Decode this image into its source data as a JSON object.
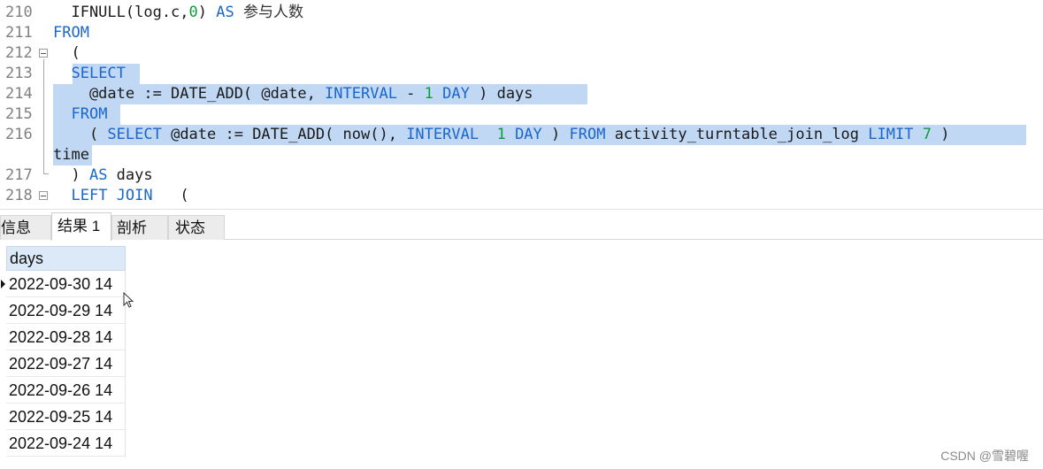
{
  "editor": {
    "lines": [
      {
        "num": "210",
        "tokens": [
          [
            "",
            "  IFNULL(log.c,"
          ],
          [
            "num",
            "0"
          ],
          [
            "",
            ") "
          ],
          [
            "kw",
            "AS"
          ],
          [
            "cn",
            " 参与人数"
          ]
        ]
      },
      {
        "num": "211",
        "tokens": [
          [
            "kw",
            "FROM"
          ]
        ]
      },
      {
        "num": "212",
        "tokens": [
          [
            "",
            "  ("
          ]
        ]
      },
      {
        "num": "213",
        "tokens": [
          [
            "",
            "  "
          ],
          [
            "kw",
            "SELECT"
          ]
        ]
      },
      {
        "num": "214",
        "tokens": [
          [
            "",
            "    @date := DATE_ADD( @date, "
          ],
          [
            "kw",
            "INTERVAL"
          ],
          [
            "",
            " - "
          ],
          [
            "num",
            "1"
          ],
          [
            "",
            " "
          ],
          [
            "kw",
            "DAY"
          ],
          [
            "",
            " ) days"
          ]
        ]
      },
      {
        "num": "215",
        "tokens": [
          [
            "",
            "  "
          ],
          [
            "kw",
            "FROM"
          ]
        ]
      },
      {
        "num": "216",
        "tokens": [
          [
            "",
            "    ( "
          ],
          [
            "kw",
            "SELECT"
          ],
          [
            "",
            " @date := DATE_ADD( now(), "
          ],
          [
            "kw",
            "INTERVAL"
          ],
          [
            "",
            "  "
          ],
          [
            "num",
            "1"
          ],
          [
            "",
            " "
          ],
          [
            "kw",
            "DAY"
          ],
          [
            "",
            " ) "
          ],
          [
            "kw",
            "FROM"
          ],
          [
            "",
            " activity_turntable_join_log "
          ],
          [
            "kw",
            "LIMIT"
          ],
          [
            "",
            " "
          ],
          [
            "num",
            "7"
          ],
          [
            "",
            " )"
          ]
        ]
      },
      {
        "num": "",
        "tokens": [
          [
            "",
            "time"
          ]
        ]
      },
      {
        "num": "217",
        "tokens": [
          [
            "",
            "  ) "
          ],
          [
            "kw",
            "AS"
          ],
          [
            "",
            " days"
          ]
        ]
      },
      {
        "num": "218",
        "tokens": [
          [
            "",
            "  "
          ],
          [
            "kw",
            "LEFT JOIN"
          ],
          [
            "",
            "   ("
          ]
        ]
      }
    ]
  },
  "tabs": [
    {
      "label": "信息",
      "active": false
    },
    {
      "label": "结果 1",
      "active": true
    },
    {
      "label": "剖析",
      "active": false
    },
    {
      "label": "状态",
      "active": false
    }
  ],
  "result": {
    "column": "days",
    "rows": [
      "2022-09-30 14",
      "2022-09-29 14",
      "2022-09-28 14",
      "2022-09-27 14",
      "2022-09-26 14",
      "2022-09-25 14",
      "2022-09-24 14"
    ],
    "current_row": 0
  },
  "watermark": "CSDN @雪碧喔",
  "colors": {
    "keyword": "#1a66cc",
    "number": "#0b9d3a",
    "selection": "#c0d8f4",
    "header": "#dbe9f8"
  }
}
